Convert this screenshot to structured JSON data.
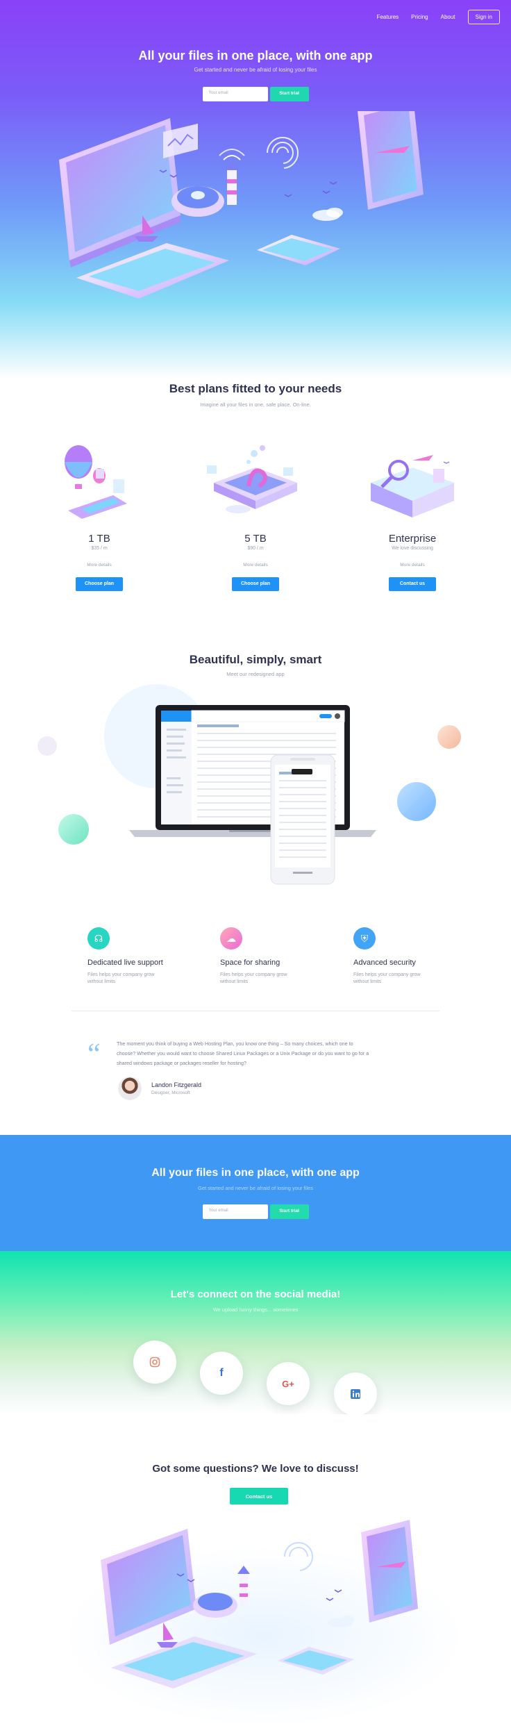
{
  "nav": {
    "items": [
      "Features",
      "Pricing",
      "About"
    ],
    "signin_label": "Sign in"
  },
  "hero": {
    "title": "All your files in one place, with one app",
    "subtitle": "Get started and never be afraid of losing your files",
    "email_placeholder": "Your email",
    "trial_label": "Start trial"
  },
  "plans": {
    "title": "Best plans fitted to your needs",
    "subtitle": "Imagine all your files in one, safe place. On-line.",
    "items": [
      {
        "name": "1 TB",
        "price": "$35 / m",
        "more": "More details",
        "button": "Choose plan"
      },
      {
        "name": "5 TB",
        "price": "$90 / m",
        "more": "More details",
        "button": "Choose plan"
      },
      {
        "name": "Enterprise",
        "price": "We love discussing",
        "more": "More details",
        "button": "Contact us"
      }
    ]
  },
  "showcase": {
    "title": "Beautiful, simply, smart",
    "subtitle": "Meet our redesigned app"
  },
  "features": [
    {
      "title": "Dedicated live support",
      "desc": "Files helps your company grow without limits",
      "icon": "headset-icon",
      "color": "#27d6c2"
    },
    {
      "title": "Space for sharing",
      "desc": "Files helps your company grow without limits",
      "icon": "cloud-icon",
      "color": "#f47fb0"
    },
    {
      "title": "Advanced security",
      "desc": "Files helps your company grow without limits",
      "icon": "shield-icon",
      "color": "#41a4f6"
    }
  ],
  "testimonial": {
    "quote": "The moment you think of buying a Web Hosting Plan, you know one thing – So many choices, which one to choose? Whether you would want to choose Shared Linux Packages or a Unix Package or do you want to go for a shared windows package or packages reseller for hosting?",
    "name": "Landon Fitzgerald",
    "role": "Designer, Microsoft"
  },
  "cta": {
    "title": "All your files in one place, with one app",
    "subtitle": "Get started and never be afraid of losing your files",
    "email_placeholder": "Your email",
    "trial_label": "Start trial"
  },
  "social": {
    "title": "Let's connect on the social media!",
    "subtitle": "We upload funny things... sometimes",
    "networks": [
      "instagram-icon",
      "facebook-icon",
      "google-plus-icon",
      "linkedin-icon"
    ]
  },
  "questions": {
    "title": "Got some questions? We love to discuss!",
    "button": "Contact us"
  },
  "colors": {
    "accent_blue": "#1f93f5",
    "accent_green": "#1fd8b0",
    "cta_bg": "#3e98f4",
    "hero_top": "#8a41f8"
  }
}
